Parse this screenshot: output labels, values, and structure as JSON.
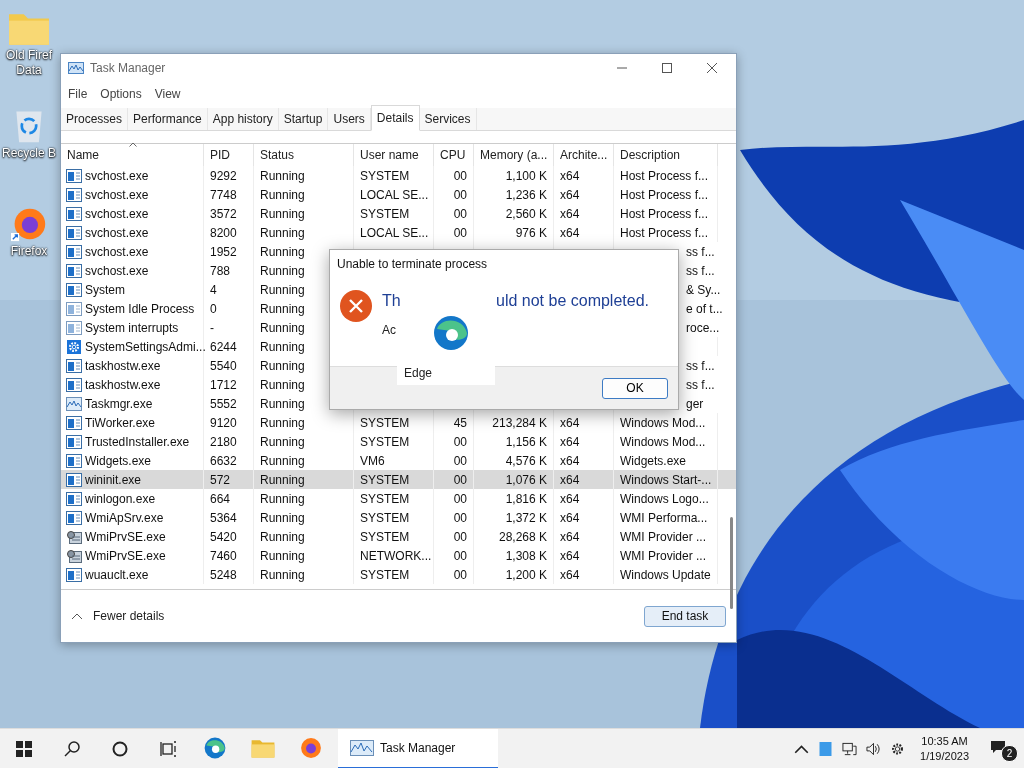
{
  "desktop_icons": [
    {
      "kind": "folder",
      "label_lines": [
        "Old Firef",
        "Data"
      ]
    },
    {
      "kind": "recycle",
      "label_lines": [
        "Recycle B"
      ]
    },
    {
      "kind": "firefox",
      "label_lines": [
        "Firefox"
      ]
    }
  ],
  "window": {
    "title": "Task Manager",
    "menu": [
      "File",
      "Options",
      "View"
    ],
    "tabs": [
      {
        "label": "Processes",
        "selected": false
      },
      {
        "label": "Performance",
        "selected": false
      },
      {
        "label": "App history",
        "selected": false
      },
      {
        "label": "Startup",
        "selected": false
      },
      {
        "label": "Users",
        "selected": false
      },
      {
        "label": "Details",
        "selected": true
      },
      {
        "label": "Services",
        "selected": false
      }
    ],
    "table": {
      "columns": [
        "Name",
        "PID",
        "Status",
        "User name",
        "CPU",
        "Memory (a...",
        "Archite...",
        "Description"
      ],
      "rows": [
        {
          "kind": "window",
          "name": "svchost.exe",
          "pid": "9292",
          "status": "Running",
          "user": "SYSTEM",
          "cpu": "00",
          "memory": "1,100 K",
          "arch": "x64",
          "description": "Host Process f...",
          "selected": false
        },
        {
          "kind": "window",
          "name": "svchost.exe",
          "pid": "7748",
          "status": "Running",
          "user": "LOCAL SE...",
          "cpu": "00",
          "memory": "1,236 K",
          "arch": "x64",
          "description": "Host Process f...",
          "selected": false
        },
        {
          "kind": "window",
          "name": "svchost.exe",
          "pid": "3572",
          "status": "Running",
          "user": "SYSTEM",
          "cpu": "00",
          "memory": "2,560 K",
          "arch": "x64",
          "description": "Host Process f...",
          "selected": false
        },
        {
          "kind": "window",
          "name": "svchost.exe",
          "pid": "8200",
          "status": "Running",
          "user": "LOCAL SE...",
          "cpu": "00",
          "memory": "976 K",
          "arch": "x64",
          "description": "Host Process f...",
          "selected": false
        },
        {
          "kind": "window",
          "name": "svchost.exe",
          "pid": "1952",
          "status": "Running",
          "description": "ss f...",
          "selected": false
        },
        {
          "kind": "window",
          "name": "svchost.exe",
          "pid": "788",
          "status": "Running",
          "description": "ss f...",
          "selected": false
        },
        {
          "kind": "window",
          "name": "System",
          "pid": "4",
          "status": "Running",
          "description": "& Sy...",
          "selected": false
        },
        {
          "kind": "idle",
          "name": "System Idle Process",
          "pid": "0",
          "status": "Running",
          "description": "e of t...",
          "selected": false
        },
        {
          "kind": "idle",
          "name": "System interrupts",
          "pid": "-",
          "status": "Running",
          "description": "roce...",
          "selected": false
        },
        {
          "kind": "settings",
          "name": "SystemSettingsAdmi...",
          "pid": "6244",
          "status": "Running",
          "selected": false
        },
        {
          "kind": "window",
          "name": "taskhostw.exe",
          "pid": "5540",
          "status": "Running",
          "description": "ss f...",
          "selected": false
        },
        {
          "kind": "window",
          "name": "taskhostw.exe",
          "pid": "1712",
          "status": "Running",
          "description": "ss f...",
          "selected": false
        },
        {
          "kind": "graph",
          "name": "Taskmgr.exe",
          "pid": "5552",
          "status": "Running",
          "description": "ger",
          "selected": false
        },
        {
          "kind": "window",
          "name": "TiWorker.exe",
          "pid": "9120",
          "status": "Running",
          "user": "SYSTEM",
          "cpu": "45",
          "memory": "213,284 K",
          "arch": "x64",
          "description": "Windows Mod...",
          "selected": false
        },
        {
          "kind": "window",
          "name": "TrustedInstaller.exe",
          "pid": "2180",
          "status": "Running",
          "user": "SYSTEM",
          "cpu": "00",
          "memory": "1,156 K",
          "arch": "x64",
          "description": "Windows Mod...",
          "selected": false
        },
        {
          "kind": "window",
          "name": "Widgets.exe",
          "pid": "6632",
          "status": "Running",
          "user": "VM6",
          "cpu": "00",
          "memory": "4,576 K",
          "arch": "x64",
          "description": "Widgets.exe",
          "selected": false
        },
        {
          "kind": "window",
          "name": "wininit.exe",
          "pid": "572",
          "status": "Running",
          "user": "SYSTEM",
          "cpu": "00",
          "memory": "1,076 K",
          "arch": "x64",
          "description": "Windows Start-...",
          "selected": true
        },
        {
          "kind": "window",
          "name": "winlogon.exe",
          "pid": "664",
          "status": "Running",
          "user": "SYSTEM",
          "cpu": "00",
          "memory": "1,816 K",
          "arch": "x64",
          "description": "Windows Logo...",
          "selected": false
        },
        {
          "kind": "window",
          "name": "WmiApSrv.exe",
          "pid": "5364",
          "status": "Running",
          "user": "SYSTEM",
          "cpu": "00",
          "memory": "1,372 K",
          "arch": "x64",
          "description": "WMI Performa...",
          "selected": false
        },
        {
          "kind": "service",
          "name": "WmiPrvSE.exe",
          "pid": "5420",
          "status": "Running",
          "user": "SYSTEM",
          "cpu": "00",
          "memory": "28,268 K",
          "arch": "x64",
          "description": "WMI Provider ...",
          "selected": false
        },
        {
          "kind": "service",
          "name": "WmiPrvSE.exe",
          "pid": "7460",
          "status": "Running",
          "user": "NETWORK...",
          "cpu": "00",
          "memory": "1,308 K",
          "arch": "x64",
          "description": "WMI Provider ...",
          "selected": false
        },
        {
          "kind": "window",
          "name": "wuauclt.exe",
          "pid": "5248",
          "status": "Running",
          "user": "SYSTEM",
          "cpu": "00",
          "memory": "1,200 K",
          "arch": "x64",
          "description": "Windows Update",
          "selected": false
        }
      ]
    },
    "footer": {
      "toggle": "Fewer details",
      "button": "End task"
    }
  },
  "dialog": {
    "title": "Unable to terminate process",
    "message_parts": [
      "Th",
      "uld not be completed."
    ],
    "detail": "Ac",
    "button": "OK"
  },
  "drag_preview": {
    "label": "Edge"
  },
  "taskbar": {
    "apps": [
      {
        "kind": "edge",
        "active": false
      },
      {
        "kind": "folder",
        "active": false
      },
      {
        "kind": "firefox",
        "active": false
      },
      {
        "kind": "taskmgr",
        "label": "Task Manager",
        "active": true
      }
    ],
    "time": "10:35 AM",
    "date": "1/19/2023",
    "notifications": "2"
  }
}
